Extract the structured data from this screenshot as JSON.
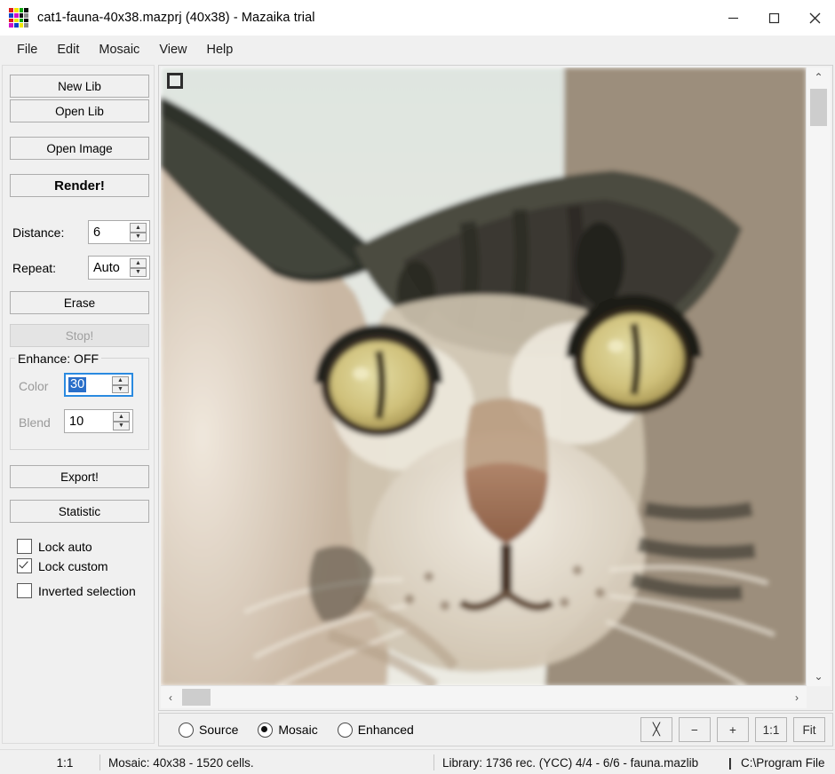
{
  "window": {
    "title": "cat1-fauna-40x38.mazprj (40x38) - Mazaika trial",
    "icon_name": "mazaika-mosaic-icon",
    "icon_colors": [
      "#e01b1b",
      "#f2e800",
      "#11a811",
      "#0a0a0a",
      "#1040c8",
      "#d011c8",
      "#111111",
      "#8a8a8a",
      "#e01b1b",
      "#f2e800",
      "#11a811",
      "#0a0a0a",
      "#d011c8",
      "#1040c8",
      "#f2e800",
      "#8a8a8a"
    ],
    "controls": {
      "minimize": "—",
      "maximize": "□",
      "close": "✕"
    }
  },
  "menubar": {
    "items": [
      {
        "label": "File"
      },
      {
        "label": "Edit"
      },
      {
        "label": "Mosaic"
      },
      {
        "label": "View"
      },
      {
        "label": "Help"
      }
    ]
  },
  "sidebar": {
    "buttons": [
      {
        "label": "New Lib",
        "state": "enabled"
      },
      {
        "label": "Open Lib",
        "state": "enabled"
      },
      {
        "label": "Open Image",
        "state": "enabled"
      },
      {
        "label": "Render!",
        "state": "enabled"
      },
      {
        "label": "Erase",
        "state": "enabled"
      },
      {
        "label": "Stop!",
        "state": "disabled"
      },
      {
        "label": "Export!",
        "state": "enabled"
      },
      {
        "label": "Statistic",
        "state": "enabled"
      }
    ],
    "distance": {
      "label": "Distance:",
      "value": "6"
    },
    "repeat": {
      "label": "Repeat:",
      "value": "Auto"
    },
    "enhance": {
      "title": "Enhance: OFF",
      "color": {
        "label": "Color",
        "value": "30",
        "enabled": false,
        "focused": true,
        "selected": true
      },
      "blend": {
        "label": "Blend",
        "value": "10",
        "enabled": false,
        "focused": false,
        "selected": false
      }
    },
    "checkboxes": [
      {
        "label": "Lock auto",
        "checked": false
      },
      {
        "label": "Lock custom",
        "checked": true
      },
      {
        "label": "Inverted selection",
        "checked": false
      }
    ]
  },
  "image_view": {
    "selection_marker": "cell-selection-square",
    "vertical_scrollbar": {
      "up": "⌃",
      "down": "⌄",
      "thumb_pos": "near-top"
    },
    "horizontal_scrollbar": {
      "left": "‹",
      "right": "›",
      "thumb_pos": "left"
    }
  },
  "bottombar": {
    "view_modes": [
      {
        "label": "Source",
        "selected": false
      },
      {
        "label": "Mosaic",
        "selected": true
      },
      {
        "label": "Enhanced",
        "selected": false
      }
    ],
    "zoom_buttons": [
      {
        "label": "╳",
        "name": "fit-width-button"
      },
      {
        "label": "−",
        "name": "zoom-out-button"
      },
      {
        "label": "+",
        "name": "zoom-in-button"
      },
      {
        "label": "1:1",
        "name": "zoom-actual-button"
      },
      {
        "label": "Fit",
        "name": "zoom-fit-button"
      }
    ]
  },
  "statusbar": {
    "zoom": "1:1",
    "mosaic_info": "Mosaic: 40x38 - 1520 cells.",
    "library_info": "Library: 1736 rec. (YCC) 4/4 - 6/6 - fauna.mazlib",
    "path_sep": "|",
    "path": "C:\\Program File"
  },
  "colors": {
    "face_bg": "#f0f0f0",
    "accent_blue": "#2a6fc9",
    "focus_blue": "#2a8ae0",
    "disabled_text": "#9a9a9a"
  }
}
